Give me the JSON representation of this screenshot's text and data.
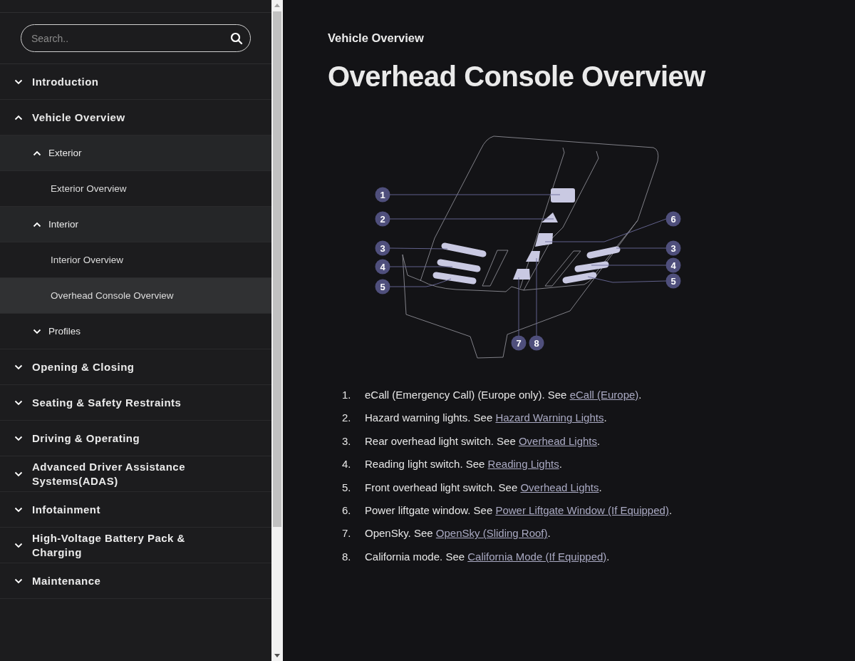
{
  "sidebar": {
    "search": {
      "placeholder": "Search.."
    },
    "items": [
      {
        "label": "Introduction",
        "expanded": false,
        "selected": false
      },
      {
        "label": "Vehicle Overview",
        "expanded": true,
        "selected": false,
        "children": [
          {
            "label": "Exterior",
            "expanded": true,
            "selected": false,
            "children": [
              {
                "label": "Exterior Overview",
                "selected": false
              }
            ]
          },
          {
            "label": "Interior",
            "expanded": true,
            "selected": false,
            "children": [
              {
                "label": "Interior Overview",
                "selected": false
              },
              {
                "label": "Overhead Console Overview",
                "selected": true
              }
            ]
          },
          {
            "label": "Profiles",
            "expanded": false,
            "selected": false
          }
        ]
      },
      {
        "label": "Opening & Closing",
        "expanded": false,
        "selected": false
      },
      {
        "label": "Seating & Safety Restraints",
        "expanded": false,
        "selected": false
      },
      {
        "label": "Driving & Operating",
        "expanded": false,
        "selected": false
      },
      {
        "label": "Advanced Driver Assistance Systems(ADAS)",
        "expanded": false,
        "selected": false
      },
      {
        "label": "Infotainment",
        "expanded": false,
        "selected": false
      },
      {
        "label": "High-Voltage Battery Pack & Charging",
        "expanded": false,
        "selected": false
      },
      {
        "label": "Maintenance",
        "expanded": false,
        "selected": false
      }
    ]
  },
  "main": {
    "breadcrumb": "Vehicle Overview",
    "title": "Overhead Console Overview",
    "diagram": {
      "callouts": [
        {
          "label": "1"
        },
        {
          "label": "2"
        },
        {
          "label": "3"
        },
        {
          "label": "4"
        },
        {
          "label": "5"
        },
        {
          "label": "6"
        },
        {
          "label": "3"
        },
        {
          "label": "4"
        },
        {
          "label": "5"
        },
        {
          "label": "7"
        },
        {
          "label": "8"
        }
      ]
    },
    "list": [
      {
        "number": "1.",
        "text": "eCall (Emergency Call) (Europe only). See ",
        "link": "eCall (Europe)",
        "after": "."
      },
      {
        "number": "2.",
        "text": "Hazard warning lights. See ",
        "link": "Hazard Warning Lights",
        "after": "."
      },
      {
        "number": "3.",
        "text": "Rear overhead light switch. See ",
        "link": "Overhead Lights",
        "after": "."
      },
      {
        "number": "4.",
        "text": "Reading light switch. See ",
        "link": "Reading Lights",
        "after": "."
      },
      {
        "number": "5.",
        "text": "Front overhead light switch. See ",
        "link": "Overhead Lights",
        "after": "."
      },
      {
        "number": "6.",
        "text": "Power liftgate window. See ",
        "link": "Power Liftgate Window (If Equipped)",
        "after": "."
      },
      {
        "number": "7.",
        "text": "OpenSky. See ",
        "link": "OpenSky (Sliding Roof)",
        "after": "."
      },
      {
        "number": "8.",
        "text": "California mode. See ",
        "link": "California Mode (If Equipped)",
        "after": "."
      }
    ]
  }
}
